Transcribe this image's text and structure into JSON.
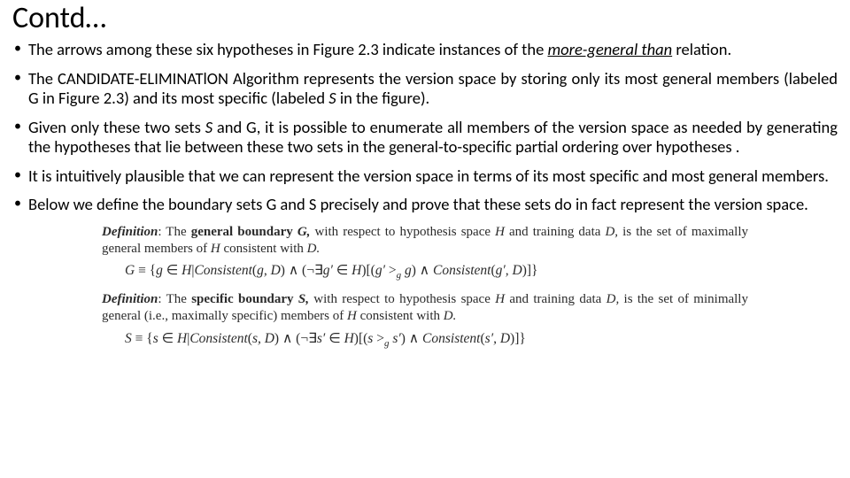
{
  "title": "Contd…",
  "bullets": {
    "b1a": "The arrows among these six hypotheses in Figure 2.3 indicate instances of the ",
    "b1b": "more-general than",
    "b1c": " relation.",
    "b2a": "The CANDIDATE-ELIMINATlON Algorithm represents the version space by storing only its most general members (labeled G in Figure 2.3) and its most specific (labeled ",
    "b2b": "S ",
    "b2c": "in the figure).",
    "b3a": "Given only these two sets ",
    "b3b": "S ",
    "b3c": "and G, it is possible to enumerate all members of the version space as needed by generating the hypotheses that lie between these two sets in the general-to-specific partial ordering over hypotheses .",
    "b4": "It is intuitively plausible that we can represent the version space in terms of its most specific and most general members.",
    "b5": "Below we define the boundary sets G and S precisely and prove that these sets do in fact represent the version space."
  },
  "defs": {
    "g_head_a": "Definition",
    "g_head_b": ": The ",
    "g_head_c": "general boundary ",
    "g_head_d": "G, ",
    "g_head_e": "with respect to hypothesis space ",
    "g_head_f": "H ",
    "g_head_g": "and training data ",
    "g_head_h": "D, ",
    "g_head_i": "is the set of maximally general members of ",
    "g_head_j": "H ",
    "g_head_k": "consistent with ",
    "g_head_l": "D.",
    "g_formula": "G ≡ {g ∈ H | Consistent(g, D) ∧ (¬∃g′ ∈ H)[(g′ >g g) ∧ Consistent(g′, D)]}",
    "s_head_a": "Definition",
    "s_head_b": ": The ",
    "s_head_c": "specific boundary ",
    "s_head_d": "S, ",
    "s_head_e": "with respect to hypothesis space ",
    "s_head_f": "H ",
    "s_head_g": "and training data ",
    "s_head_h": "D, ",
    "s_head_i": "is the set of minimally general (i.e., maximally specific) members of ",
    "s_head_j": "H ",
    "s_head_k": "consistent with ",
    "s_head_l": "D.",
    "s_formula": "S ≡ {s ∈ H | Consistent(s, D) ∧ (¬∃s′ ∈ H)[(s >g s′) ∧ Consistent(s′, D)]}"
  }
}
